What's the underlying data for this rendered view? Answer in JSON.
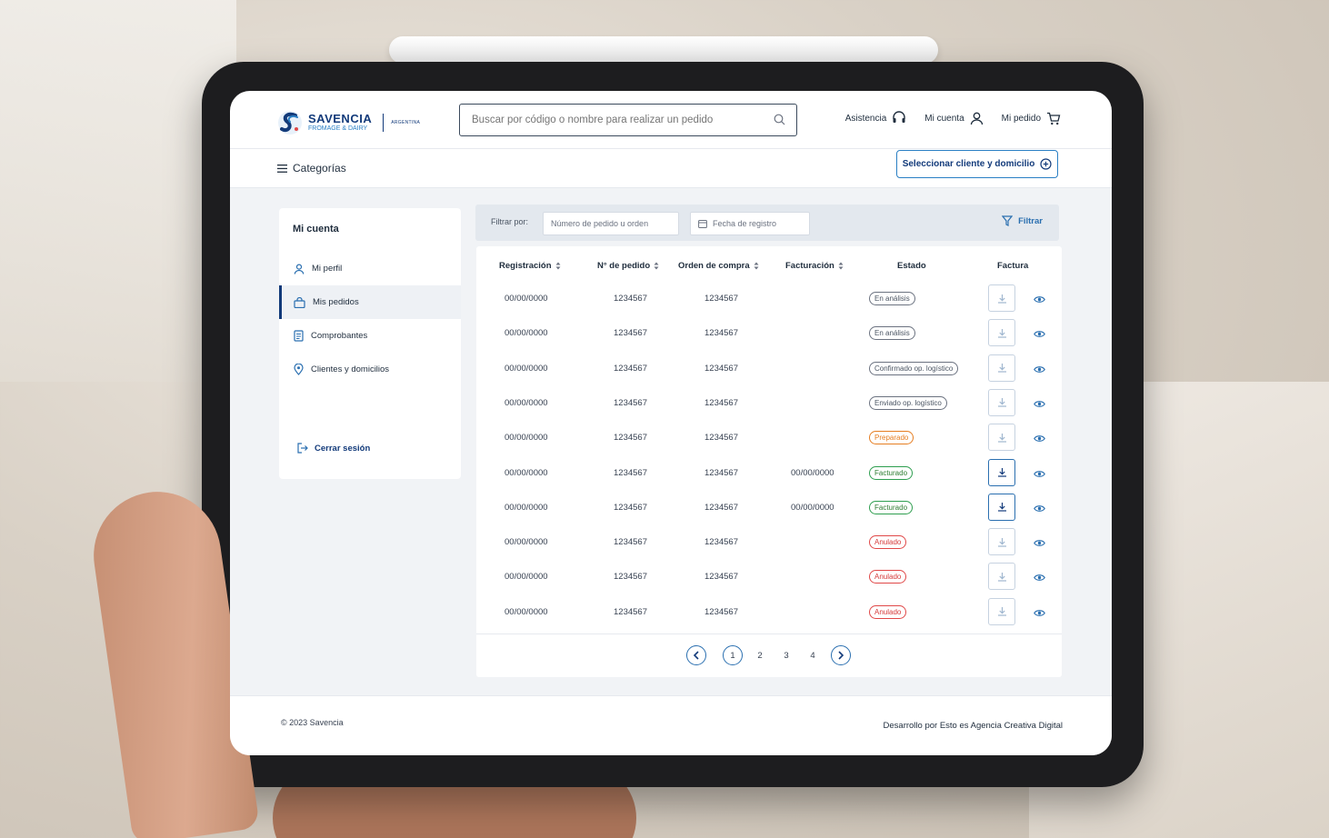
{
  "brand": {
    "name": "SAVENCIA",
    "tagline": "FROMAGE & DAIRY",
    "country": "ARGENTINA"
  },
  "search": {
    "placeholder": "Buscar por código o nombre para realizar un pedido"
  },
  "header_links": {
    "assistance": "Asistencia",
    "account": "Mi cuenta",
    "order": "Mi pedido"
  },
  "subheader": {
    "categories": "Categorías",
    "select_client": "Seleccionar cliente y domicilio"
  },
  "sidebar": {
    "title": "Mi cuenta",
    "items": [
      {
        "label": "Mi perfil",
        "icon": "user-icon",
        "active": false
      },
      {
        "label": "Mis pedidos",
        "icon": "shopping-bag-icon",
        "active": true
      },
      {
        "label": "Comprobantes",
        "icon": "document-icon",
        "active": false
      },
      {
        "label": "Clientes y domicilios",
        "icon": "location-pin-icon",
        "active": false
      }
    ],
    "logout": "Cerrar sesión"
  },
  "filters": {
    "label": "Filtrar por:",
    "order_placeholder": "Número de pedido u orden",
    "date_placeholder": "Fecha de registro",
    "button": "Filtrar"
  },
  "table": {
    "columns": [
      "Registración",
      "N° de pedido",
      "Orden de compra",
      "Facturación",
      "Estado",
      "Factura"
    ],
    "rows": [
      {
        "registro": "00/00/0000",
        "pedido": "1234567",
        "orden": "1234567",
        "facturacion": "",
        "estado": "En análisis",
        "tone": "gray",
        "download": false
      },
      {
        "registro": "00/00/0000",
        "pedido": "1234567",
        "orden": "1234567",
        "facturacion": "",
        "estado": "En análisis",
        "tone": "gray",
        "download": false
      },
      {
        "registro": "00/00/0000",
        "pedido": "1234567",
        "orden": "1234567",
        "facturacion": "",
        "estado": "Confirmado op. logístico",
        "tone": "gray",
        "download": false
      },
      {
        "registro": "00/00/0000",
        "pedido": "1234567",
        "orden": "1234567",
        "facturacion": "",
        "estado": "Enviado op. logístico",
        "tone": "gray",
        "download": false
      },
      {
        "registro": "00/00/0000",
        "pedido": "1234567",
        "orden": "1234567",
        "facturacion": "",
        "estado": "Preparado",
        "tone": "orange",
        "download": false
      },
      {
        "registro": "00/00/0000",
        "pedido": "1234567",
        "orden": "1234567",
        "facturacion": "00/00/0000",
        "estado": "Facturado",
        "tone": "green",
        "download": true
      },
      {
        "registro": "00/00/0000",
        "pedido": "1234567",
        "orden": "1234567",
        "facturacion": "00/00/0000",
        "estado": "Facturado",
        "tone": "green",
        "download": true
      },
      {
        "registro": "00/00/0000",
        "pedido": "1234567",
        "orden": "1234567",
        "facturacion": "",
        "estado": "Anulado",
        "tone": "red",
        "download": false
      },
      {
        "registro": "00/00/0000",
        "pedido": "1234567",
        "orden": "1234567",
        "facturacion": "",
        "estado": "Anulado",
        "tone": "red",
        "download": false
      },
      {
        "registro": "00/00/0000",
        "pedido": "1234567",
        "orden": "1234567",
        "facturacion": "",
        "estado": "Anulado",
        "tone": "red",
        "download": false
      }
    ]
  },
  "pagination": {
    "pages": [
      "1",
      "2",
      "3",
      "4"
    ],
    "current": "1"
  },
  "footer": {
    "copyright": "© 2023 Savencia",
    "credit": "Desarrollo por Esto es Agencia Creativa Digital"
  },
  "colors": {
    "brand_dark": "#123a7a",
    "accent": "#2a6fb0",
    "orange": "#e67e22",
    "green": "#2e9e4f",
    "red": "#e04848"
  }
}
